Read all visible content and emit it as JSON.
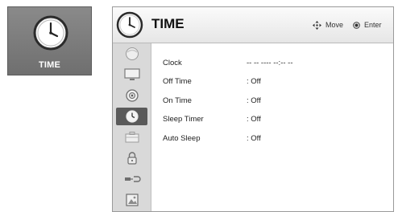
{
  "category_tile": {
    "label": "TIME",
    "icon": "clock-icon"
  },
  "header": {
    "title": "TIME",
    "hints": [
      {
        "icon": "four-way-arrows-icon",
        "label": "Move"
      },
      {
        "icon": "enter-dot-icon",
        "label": "Enter"
      }
    ]
  },
  "sidebar": {
    "items": [
      {
        "icon": "picture-icon",
        "active": false
      },
      {
        "icon": "monitor-icon",
        "active": false
      },
      {
        "icon": "audio-icon",
        "active": false
      },
      {
        "icon": "clock-icon",
        "active": true
      },
      {
        "icon": "option-icon",
        "active": false
      },
      {
        "icon": "lock-icon",
        "active": false
      },
      {
        "icon": "input-icon",
        "active": false
      },
      {
        "icon": "photo-icon",
        "active": false
      }
    ]
  },
  "menu": {
    "items": [
      {
        "label": "Clock",
        "value": "-- -- ---- --:-- --"
      },
      {
        "label": "Off Time",
        "value": ": Off"
      },
      {
        "label": "On Time",
        "value": ": Off"
      },
      {
        "label": "Sleep Timer",
        "value": ": Off"
      },
      {
        "label": "Auto Sleep",
        "value": ": Off"
      }
    ]
  },
  "colors": {
    "tile_bg": "#7d7d7d",
    "active_icon_bg": "#5a5a5a",
    "strip_bg": "#d9d9d9"
  }
}
